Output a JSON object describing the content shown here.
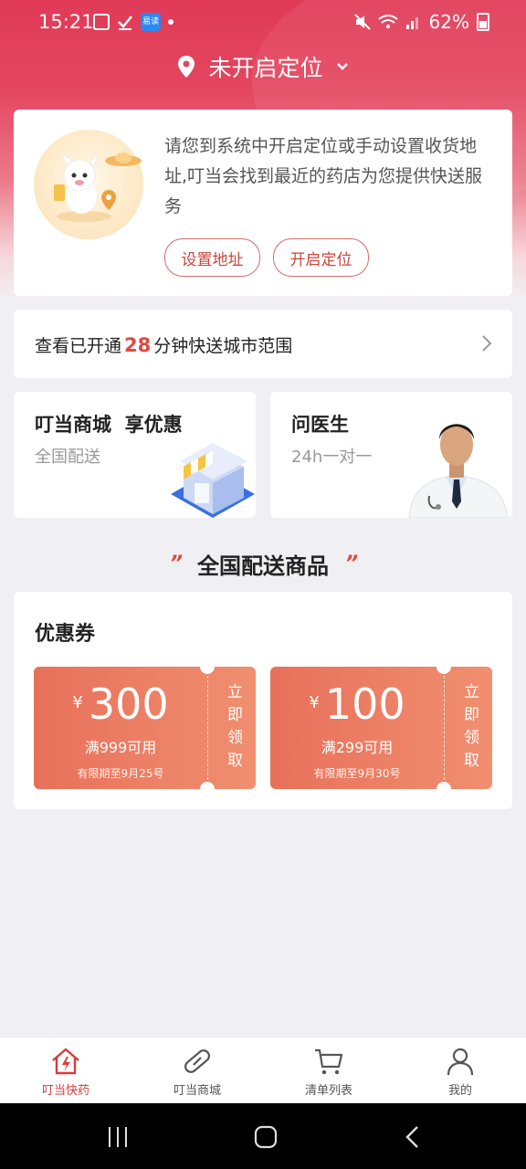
{
  "status_bar": {
    "time": "15:21",
    "app_badge": "易读",
    "battery": "62%"
  },
  "location": {
    "label": "未开启定位"
  },
  "location_card": {
    "message": "请您到系统中开启定位或手动设置收货地址,叮当会找到最近的药店为您提供快送服务",
    "set_address": "设置地址",
    "enable_location": "开启定位"
  },
  "express_cities": {
    "prefix": "查看已开通",
    "minutes": "28",
    "suffix": "分钟快送城市范围"
  },
  "mall_card": {
    "title": "叮当商城  享优惠",
    "subtitle": "全国配送"
  },
  "doctor_card": {
    "title": "问医生",
    "subtitle": "24h一对一"
  },
  "section": {
    "title": "全国配送商品",
    "quote_mark": "”"
  },
  "coupons": {
    "title": "优惠券",
    "items": [
      {
        "currency": "¥",
        "amount": "300",
        "condition": "满999可用",
        "expiry": "有限期至9月25号",
        "claim": [
          "立",
          "即",
          "领",
          "取"
        ]
      },
      {
        "currency": "¥",
        "amount": "100",
        "condition": "满299可用",
        "expiry": "有限期至9月30号",
        "claim": [
          "立",
          "即",
          "领",
          "取"
        ]
      }
    ]
  },
  "bottom_nav": [
    {
      "label": "叮当快药",
      "icon": "home-bolt-icon",
      "active": true
    },
    {
      "label": "叮当商城",
      "icon": "pill-icon",
      "active": false
    },
    {
      "label": "清单列表",
      "icon": "cart-icon",
      "active": false
    },
    {
      "label": "我的",
      "icon": "user-icon",
      "active": false
    }
  ],
  "colors": {
    "brand_red": "#e0483e",
    "header_red": "#e03a57",
    "coupon_orange": "#ec7d64"
  }
}
